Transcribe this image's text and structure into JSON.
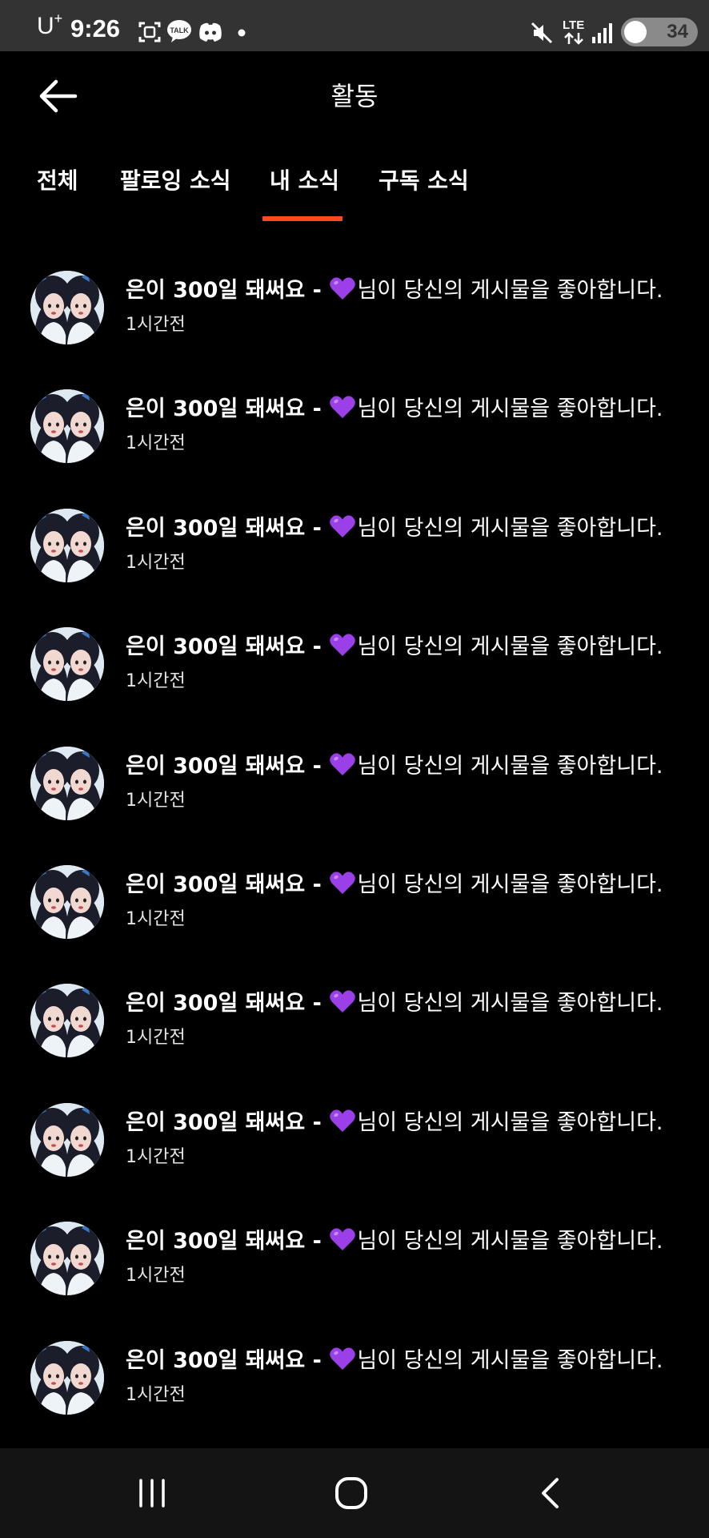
{
  "status_bar": {
    "carrier": "U",
    "carrier_sup": "+",
    "time": "9:26",
    "network": "LTE",
    "battery": "34",
    "icons": [
      "screenshot-icon",
      "kakaotalk-icon",
      "discord-icon",
      "dot-icon",
      "mute-icon",
      "lte-icon",
      "signal-icon",
      "battery-icon"
    ]
  },
  "header": {
    "title": "활동",
    "back_icon": "arrow-left-icon"
  },
  "tabs": [
    {
      "label": "전체",
      "active": false
    },
    {
      "label": "팔로잉 소식",
      "active": false
    },
    {
      "label": "내 소식",
      "active": true
    },
    {
      "label": "구독 소식",
      "active": false
    }
  ],
  "accent_color": "#ff4a1c",
  "notifications": [
    {
      "post_title": "은이 300일 돼써요 -",
      "emoji": "purple-heart",
      "text": "님이 당신의 게시물을 좋아합니다.",
      "time": "1시간전"
    },
    {
      "post_title": "은이 300일 돼써요 -",
      "emoji": "purple-heart",
      "text": "님이 당신의 게시물을 좋아합니다.",
      "time": "1시간전"
    },
    {
      "post_title": "은이 300일 돼써요 -",
      "emoji": "purple-heart",
      "text": "님이 당신의 게시물을 좋아합니다.",
      "time": "1시간전"
    },
    {
      "post_title": "은이 300일 돼써요 -",
      "emoji": "purple-heart",
      "text": "님이 당신의 게시물을 좋아합니다.",
      "time": "1시간전"
    },
    {
      "post_title": "은이 300일 돼써요 -",
      "emoji": "purple-heart",
      "text": "님이 당신의 게시물을 좋아합니다.",
      "time": "1시간전"
    },
    {
      "post_title": "은이 300일 돼써요 -",
      "emoji": "purple-heart",
      "text": "님이 당신의 게시물을 좋아합니다.",
      "time": "1시간전"
    },
    {
      "post_title": "은이 300일 돼써요 -",
      "emoji": "purple-heart",
      "text": "님이 당신의 게시물을 좋아합니다.",
      "time": "1시간전"
    },
    {
      "post_title": "은이 300일 돼써요 -",
      "emoji": "purple-heart",
      "text": "님이 당신의 게시물을 좋아합니다.",
      "time": "1시간전"
    },
    {
      "post_title": "은이 300일 돼써요 -",
      "emoji": "purple-heart",
      "text": "님이 당신의 게시물을 좋아합니다.",
      "time": "1시간전"
    },
    {
      "post_title": "은이 300일 돼써요 -",
      "emoji": "purple-heart",
      "text": "님이 당신의 게시물을 좋아합니다.",
      "time": "1시간전"
    }
  ],
  "nav_bar": {
    "icons": [
      "recent-apps-icon",
      "home-icon",
      "back-icon"
    ]
  }
}
